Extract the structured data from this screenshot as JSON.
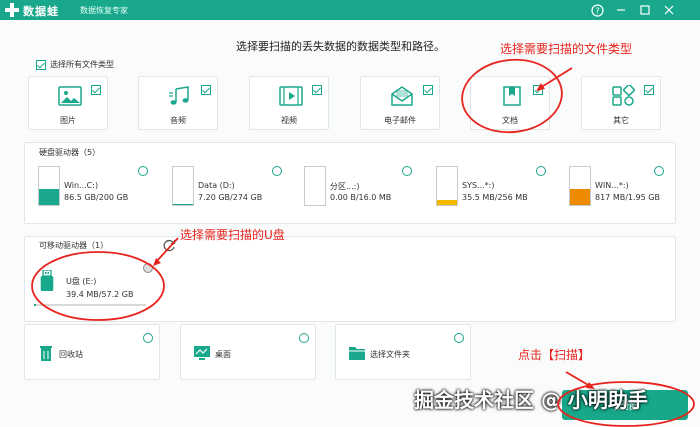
{
  "app": {
    "name": "数据蛙",
    "subtitle": "数据恢复专家"
  },
  "window_controls": {
    "help_icon": "help-circle-icon",
    "minimize_icon": "minimize-icon",
    "restore_icon": "restore-icon",
    "close_icon": "close-icon"
  },
  "instruction": "选择要扫描的丢失数据的数据类型和路径。",
  "select_all": {
    "label": "选择所有文件类型",
    "checked": true
  },
  "file_types": [
    {
      "label": "图片",
      "icon": "image-icon",
      "checked": true
    },
    {
      "label": "音频",
      "icon": "audio-icon",
      "checked": true
    },
    {
      "label": "视频",
      "icon": "video-icon",
      "checked": true
    },
    {
      "label": "电子邮件",
      "icon": "email-icon",
      "checked": true
    },
    {
      "label": "文档",
      "icon": "document-icon",
      "checked": true
    },
    {
      "label": "其它",
      "icon": "other-icon",
      "checked": true
    }
  ],
  "hard_drives": {
    "title": "硬盘驱动器（5）",
    "items": [
      {
        "name": "Win...C:)",
        "size": "86.5 GB/200 GB",
        "used_fraction": 0.43,
        "color": "#1aa88c"
      },
      {
        "name": "Data (D:)",
        "size": "7.20 GB/274 GB",
        "used_fraction": 0.03,
        "color": "#1aa88c"
      },
      {
        "name": "分区...:)",
        "size": "0.00  B/16.0 MB",
        "used_fraction": 0.0,
        "color": "#1aa88c"
      },
      {
        "name": "SYS...*:)",
        "size": "35.5 MB/256 MB",
        "used_fraction": 0.14,
        "color": "#f5b800"
      },
      {
        "name": "WIN...*:)",
        "size": "817 MB/1.95 GB",
        "used_fraction": 0.41,
        "color": "#ee8a00"
      }
    ]
  },
  "removable": {
    "title": "可移动驱动器（1）",
    "refresh_icon": "refresh-icon",
    "items": [
      {
        "name": "U盘 (E:)",
        "size": "39.4 MB/57.2 GB",
        "used_fraction": 0.02
      }
    ]
  },
  "locations": [
    {
      "label": "回收站",
      "icon": "recycle-bin-icon"
    },
    {
      "label": "桌面",
      "icon": "desktop-icon"
    },
    {
      "label": "选择文件夹",
      "icon": "folder-icon"
    }
  ],
  "scan_button": "扫描",
  "annotations": {
    "file_type": "选择需要扫描的文件类型",
    "usb": "选择需要扫描的U盘",
    "scan": "点击【扫描】"
  },
  "watermark": "掘金技术社区 @ 小明助手",
  "colors": {
    "brand": "#1aa88c",
    "annotation": "#e8231d"
  }
}
